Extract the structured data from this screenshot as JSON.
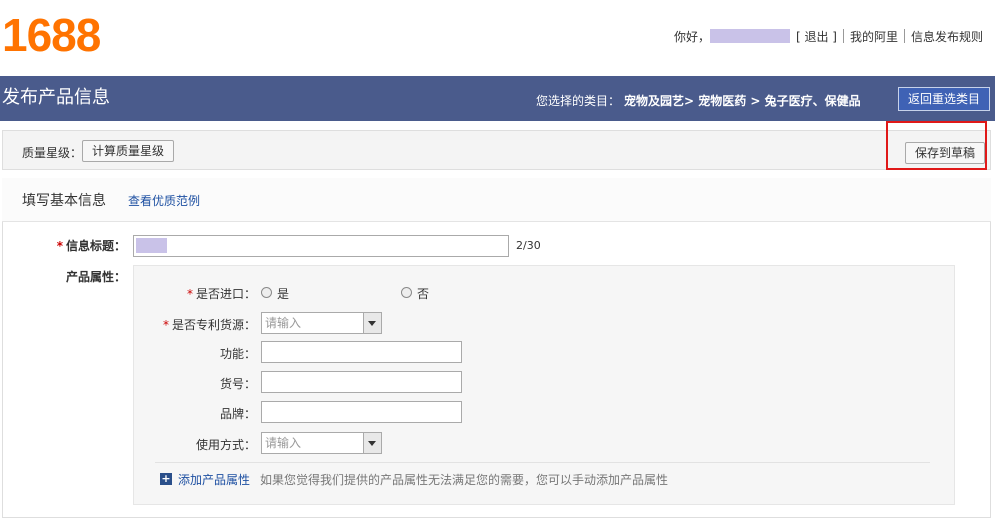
{
  "header": {
    "logo_text": "1688",
    "greeting": "你好，",
    "username_mask_color": "#c9c2e8",
    "logout_label": "[ 退出 ]",
    "my_alibaba_label": "我的阿里",
    "rules_label": "信息发布规则"
  },
  "titlebar": {
    "page_title": "发布产品信息",
    "category_label": "您选择的类目：",
    "category_path": "宠物及园艺> 宠物医药 > 兔子医疗、保健品",
    "reselect_button": "返回重选类目"
  },
  "quality": {
    "label": "质量星级：",
    "calc_button": "计算质量星级",
    "save_draft_button": "保存到草稿"
  },
  "section": {
    "title": "填写基本信息",
    "sample_link": "查看优质范例"
  },
  "form": {
    "title_label": "信息标题：",
    "title_counter": "2/30",
    "attributes_label": "产品属性：",
    "imported": {
      "label": "是否进口：",
      "options": [
        "是",
        "否"
      ]
    },
    "patent_source": {
      "label": "是否专利货源：",
      "placeholder": "请输入"
    },
    "function_label": "功能：",
    "item_no_label": "货号：",
    "brand_label": "品牌：",
    "usage": {
      "label": "使用方式：",
      "placeholder": "请输入"
    },
    "add_attr_link": "添加产品属性",
    "add_attr_hint": "如果您觉得我们提供的产品属性无法满足您的需要，您可以手动添加产品属性"
  }
}
